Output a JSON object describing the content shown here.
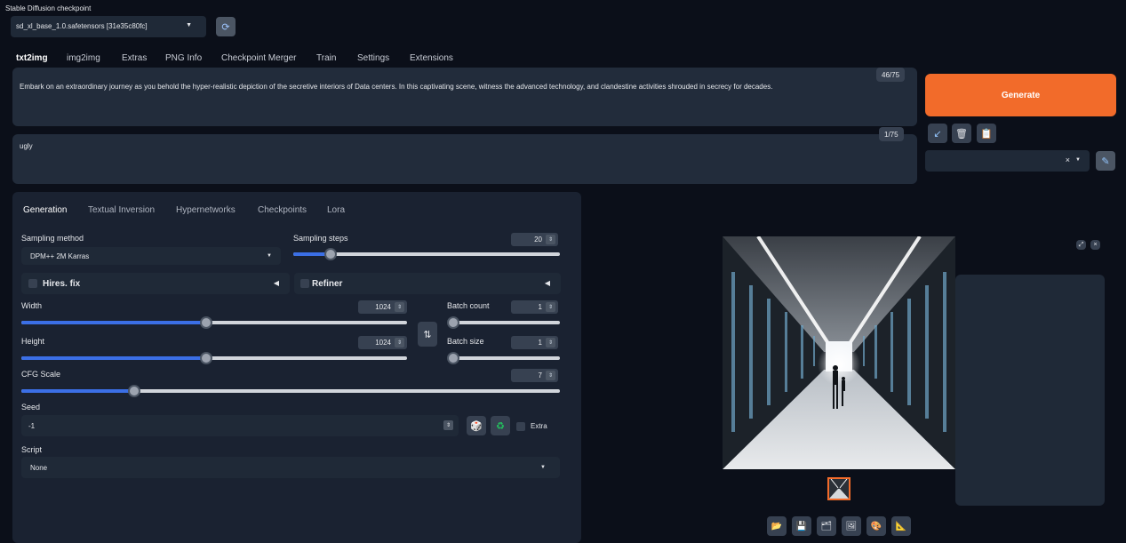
{
  "checkpoint": {
    "label": "Stable Diffusion checkpoint",
    "value": "sd_xl_base_1.0.safetensors [31e35c80fc]"
  },
  "tabs": [
    "txt2img",
    "img2img",
    "Extras",
    "PNG Info",
    "Checkpoint Merger",
    "Train",
    "Settings",
    "Extensions"
  ],
  "prompt": {
    "text": "Embark on an extraordinary journey as you behold the hyper-realistic depiction of the secretive interiors of Data centers. In this captivating scene, witness the advanced technology, and clandestine activities shrouded in secrecy for decades.",
    "token_count": "46/75"
  },
  "negative_prompt": {
    "text": "ugly",
    "token_count": "1/75"
  },
  "generate_label": "Generate",
  "subtabs": [
    "Generation",
    "Textual Inversion",
    "Hypernetworks",
    "Checkpoints",
    "Lora"
  ],
  "sampling_method": {
    "label": "Sampling method",
    "value": "DPM++ 2M Karras"
  },
  "sampling_steps": {
    "label": "Sampling steps",
    "value": "20",
    "fraction": 0.14
  },
  "hires_fix": {
    "label": "Hires. fix"
  },
  "refiner": {
    "label": "Refiner"
  },
  "width": {
    "label": "Width",
    "value": "1024",
    "fraction": 0.48
  },
  "height": {
    "label": "Height",
    "value": "1024",
    "fraction": 0.48
  },
  "batch_count": {
    "label": "Batch count",
    "value": "1",
    "fraction": 0.0
  },
  "batch_size": {
    "label": "Batch size",
    "value": "1",
    "fraction": 0.0
  },
  "cfg_scale": {
    "label": "CFG Scale",
    "value": "7",
    "fraction": 0.21
  },
  "seed": {
    "label": "Seed",
    "value": "-1",
    "extra_label": "Extra"
  },
  "script": {
    "label": "Script",
    "value": "None"
  },
  "colors": {
    "accent": "#3b6fe6",
    "generate": "#f26b2a",
    "background": "#0b0f19"
  }
}
